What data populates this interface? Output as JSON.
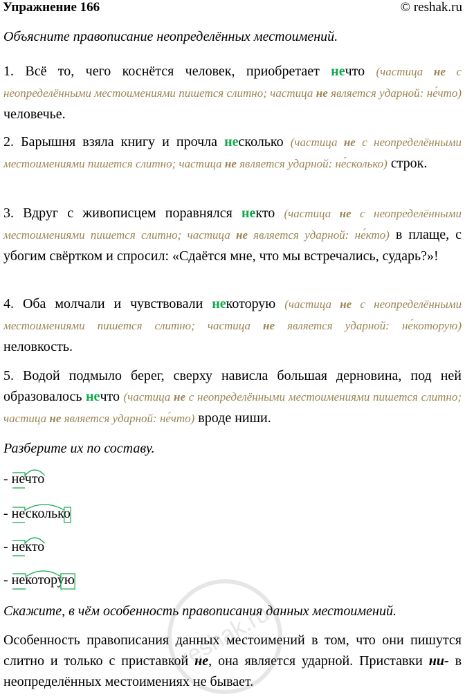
{
  "header": {
    "title": "Упражнение 166",
    "source": "© reshak.ru"
  },
  "task1": "Объясните правописание неопределённых местоимений.",
  "note_parts": [
    "частица",
    "не",
    "с неопределёнными местоимениями пишется слитно; частица",
    "не",
    "является ударной:"
  ],
  "items": [
    {
      "num": "1.",
      "before": "Всё то, чего коснётся человек, приобретает",
      "hl": "не",
      "rest": "что",
      "stressed": "не́что",
      "after": "человечье."
    },
    {
      "num": "2.",
      "before": "Барышня взяла книгу и прочла",
      "hl": "не",
      "rest": "сколько",
      "stressed": "не́сколько",
      "after": "строк."
    },
    {
      "num": "3.",
      "before": "Вдруг с живописцем поравнялся",
      "hl": "не",
      "rest": "кто",
      "stressed": "не́кто",
      "after": "в плаще, с убогим свёртком и спросил: «Сдаётся мне, что мы встречались, сударь?»!"
    },
    {
      "num": "4.",
      "before": "Оба молчали и чувствовали",
      "hl": "не",
      "rest": "которую",
      "stressed": "не́которую",
      "after": "неловкость."
    },
    {
      "num": "5.",
      "before": "Водой подмыло берег, сверху нависла большая дерновина, под ней образовалось",
      "hl": "не",
      "rest": "что",
      "stressed": "не́что",
      "after": "вроде ниши."
    }
  ],
  "task2": "Разберите их по составу.",
  "morph": [
    {
      "prefix": "- ",
      "word": "нечто"
    },
    {
      "prefix": "- ",
      "word": "несколько"
    },
    {
      "prefix": "- ",
      "word": "некто"
    },
    {
      "prefix": "- ",
      "word": "некоторую"
    }
  ],
  "task3": "Скажите, в чём особенность правописания данных местоимений.",
  "answer": {
    "part1": "Особенность правописания данных местоимений в том, что они пишутся слитно и только с приставкой",
    "bold1": "не",
    "part2": ", она является ударной. Приставки",
    "bold2": "ни-",
    "part3": "в неопределённых местоимениях не бывает."
  },
  "watermark": "reshak.ru",
  "colors": {
    "highlight": "#10a84a",
    "note": "#9c8555",
    "morph_lines": "#10a84a"
  }
}
